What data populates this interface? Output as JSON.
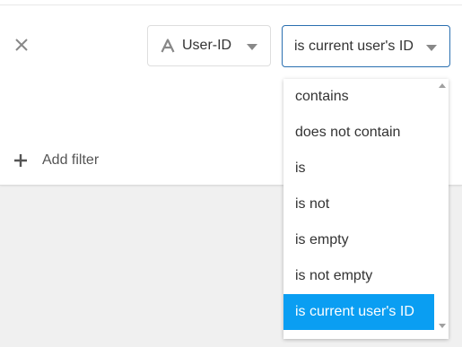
{
  "filter": {
    "field": {
      "icon": "text-field-type-icon",
      "label": "User-ID"
    },
    "operator": {
      "value": "is current user's ID",
      "options": [
        {
          "label": "contains",
          "selected": false
        },
        {
          "label": "does not contain",
          "selected": false
        },
        {
          "label": "is",
          "selected": false
        },
        {
          "label": "is not",
          "selected": false
        },
        {
          "label": "is empty",
          "selected": false
        },
        {
          "label": "is not empty",
          "selected": false
        },
        {
          "label": "is current user's ID",
          "selected": true
        }
      ]
    }
  },
  "add_filter": {
    "label": "Add filter"
  },
  "colors": {
    "accent": "#0a9ef2",
    "focus_border": "#2a6fb0",
    "background": "#f0f0f0"
  }
}
